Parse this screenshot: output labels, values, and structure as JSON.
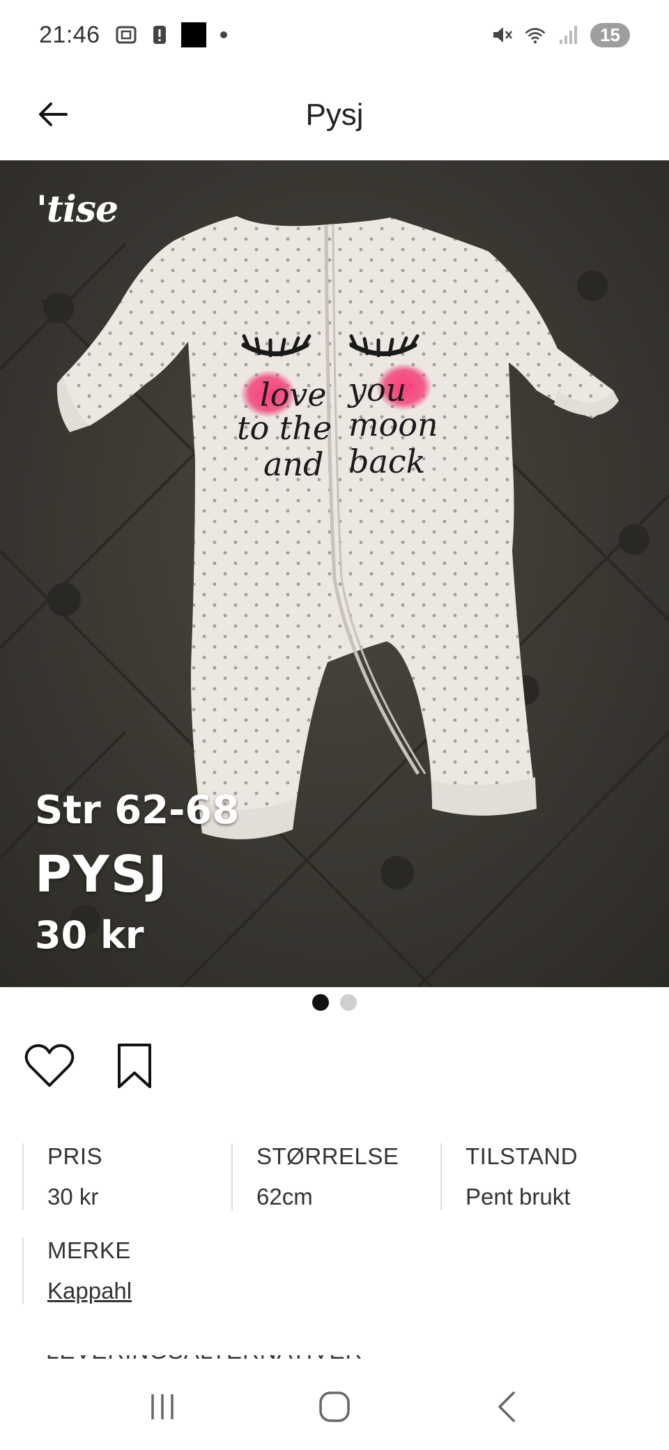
{
  "status_bar": {
    "time": "21:46",
    "left_icons": [
      "screenshot-icon",
      "alert-icon",
      "app-thumbnail-icon",
      "dot-icon"
    ],
    "right_icons": [
      "mute-icon",
      "wifi-icon",
      "signal-icon"
    ],
    "battery": "15"
  },
  "header": {
    "title": "Pysj",
    "back_icon": "arrow-left-icon"
  },
  "listing_image": {
    "watermark": "'tise",
    "overlay_size": "Str 62-68",
    "overlay_name": "PYSJ",
    "overlay_price": "30 kr",
    "print_text_left": [
      "love",
      "to the",
      "and"
    ],
    "print_text_right": [
      "you",
      "moon",
      "back"
    ],
    "image_count": 2,
    "active_image": 1
  },
  "actions": {
    "like_icon": "heart-icon",
    "save_icon": "bookmark-icon"
  },
  "details": [
    {
      "label": "PRIS",
      "value": "30 kr"
    },
    {
      "label": "STØRRELSE",
      "value": "62cm"
    },
    {
      "label": "TILSTAND",
      "value": "Pent brukt"
    }
  ],
  "brand": {
    "label": "MERKE",
    "value": "Kappahl"
  },
  "next_section_label": "LEVERINGSALTERNATIVER",
  "nav_bar": [
    "recent-apps-icon",
    "home-icon",
    "back-icon"
  ],
  "colors": {
    "background": "#ffffff",
    "photo_bg": "#3a3832",
    "text": "#333333",
    "pager_active": "#111111",
    "pager_inactive": "#cfcfcf",
    "battery_badge": "#9e9e9e",
    "blush_pink": "#f0457a"
  }
}
